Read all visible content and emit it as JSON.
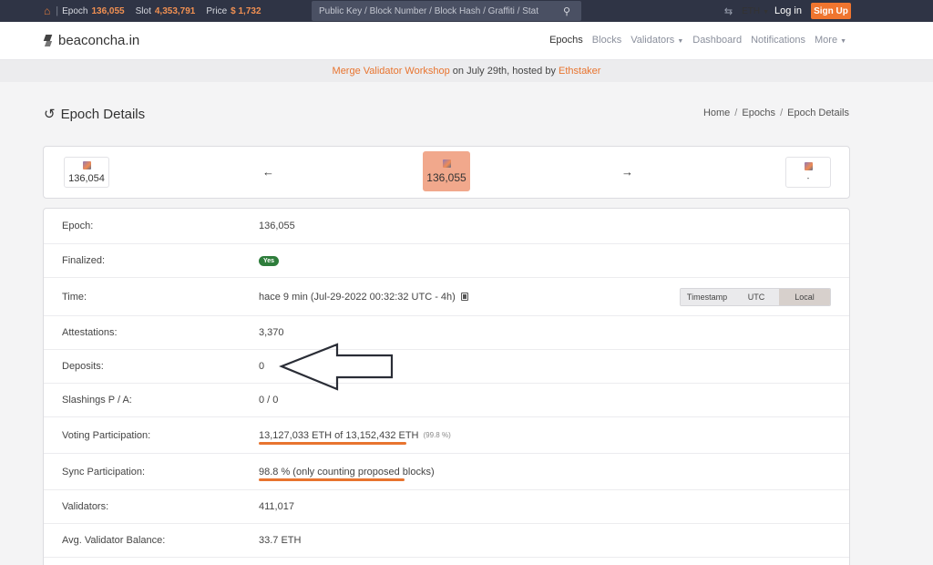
{
  "topbar": {
    "epoch_label": "Epoch",
    "epoch_value": "136,055",
    "slot_label": "Slot",
    "slot_value": "4,353,791",
    "price_label": "Price",
    "price_value": "$ 1,732",
    "search_placeholder": "Public Key / Block Number / Block Hash / Graffiti / Stat",
    "currency": "ETH",
    "login": "Log in",
    "signup": "Sign Up"
  },
  "navbar": {
    "brand": "beaconcha.in",
    "items": [
      "Epochs",
      "Blocks",
      "Validators",
      "Dashboard",
      "Notifications",
      "More"
    ]
  },
  "banner": {
    "link1": "Merge Validator Workshop",
    "middle": " on July 29th, hosted by ",
    "link2": "Ethstaker"
  },
  "page": {
    "title": "Epoch Details",
    "breadcrumb": [
      "Home",
      "Epochs",
      "Epoch Details"
    ]
  },
  "epoch_nav": {
    "prev": "136,054",
    "current": "136,055",
    "next": "-"
  },
  "details": {
    "epoch": {
      "label": "Epoch:",
      "value": "136,055"
    },
    "finalized": {
      "label": "Finalized:",
      "value": "Yes"
    },
    "time": {
      "label": "Time:",
      "value": "hace 9 min (Jul-29-2022 00:32:32 UTC - 4h)",
      "toggles": [
        "Timestamp",
        "UTC",
        "Local"
      ]
    },
    "attestations": {
      "label": "Attestations:",
      "value": "3,370"
    },
    "deposits": {
      "label": "Deposits:",
      "value": "0"
    },
    "slashings": {
      "label": "Slashings P / A:",
      "value": "0 / 0"
    },
    "voting": {
      "label": "Voting Participation:",
      "value": "13,127,033 ETH of 13,152,432 ETH",
      "percent": "(99.8 %)"
    },
    "sync": {
      "label": "Sync Participation:",
      "value": "98.8 % (only counting proposed blocks)"
    },
    "validators": {
      "label": "Validators:",
      "value": "411,017"
    },
    "avg_balance": {
      "label": "Avg. Validator Balance:",
      "value": "33.7 ETH"
    }
  }
}
